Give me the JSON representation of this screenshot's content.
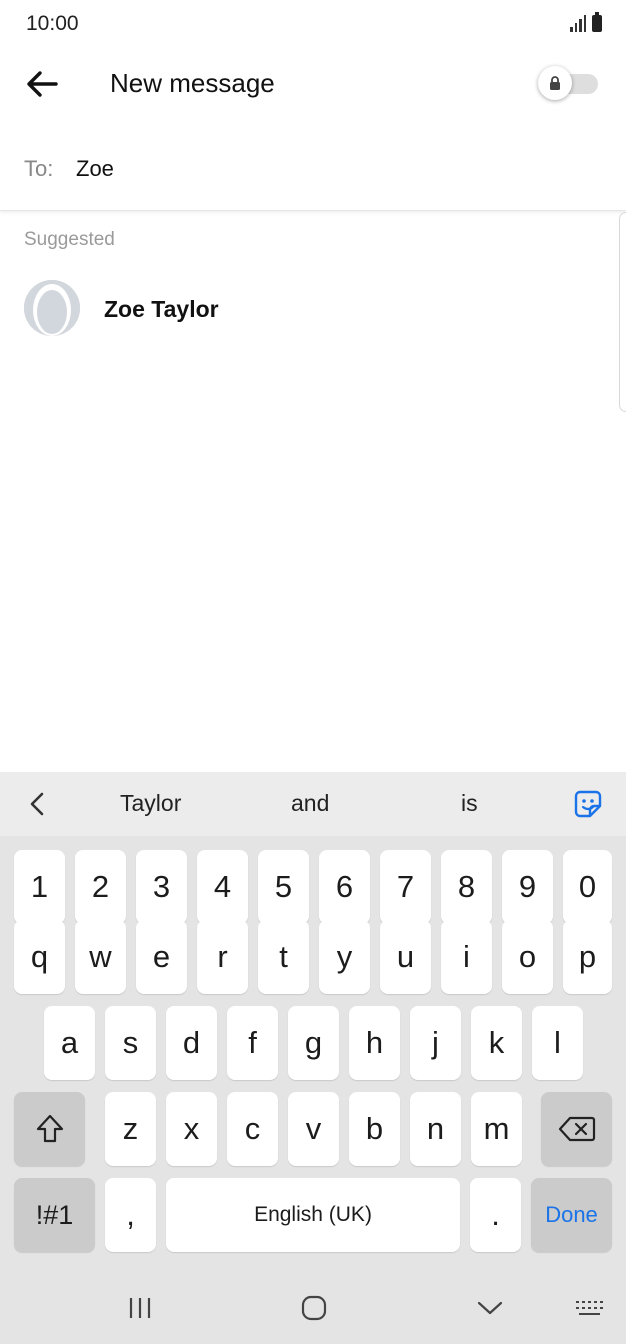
{
  "status_bar": {
    "time": "10:00"
  },
  "app_bar": {
    "title": "New message"
  },
  "recipient": {
    "label": "To:",
    "value": "Zoe"
  },
  "suggestions": {
    "heading": "Suggested",
    "contacts": [
      {
        "name": "Zoe Taylor"
      }
    ]
  },
  "keyboard": {
    "predictions": [
      "Taylor",
      "and",
      "is"
    ],
    "number_row": [
      "1",
      "2",
      "3",
      "4",
      "5",
      "6",
      "7",
      "8",
      "9",
      "0"
    ],
    "row1": [
      "q",
      "w",
      "e",
      "r",
      "t",
      "y",
      "u",
      "i",
      "o",
      "p"
    ],
    "row2": [
      "a",
      "s",
      "d",
      "f",
      "g",
      "h",
      "j",
      "k",
      "l"
    ],
    "row3": [
      "z",
      "x",
      "c",
      "v",
      "b",
      "n",
      "m"
    ],
    "symbols_label": "!#1",
    "comma_label": ",",
    "space_label": "English (UK)",
    "period_label": ".",
    "done_label": "Done",
    "accent_color": "#1a73e8"
  },
  "icons": [
    "back-arrow-icon",
    "lock-icon",
    "avatar-placeholder-icon",
    "chevron-left-icon",
    "sticker-icon",
    "shift-icon",
    "backspace-icon",
    "recents-icon",
    "home-icon",
    "hide-keyboard-icon",
    "keyboard-grid-icon"
  ]
}
